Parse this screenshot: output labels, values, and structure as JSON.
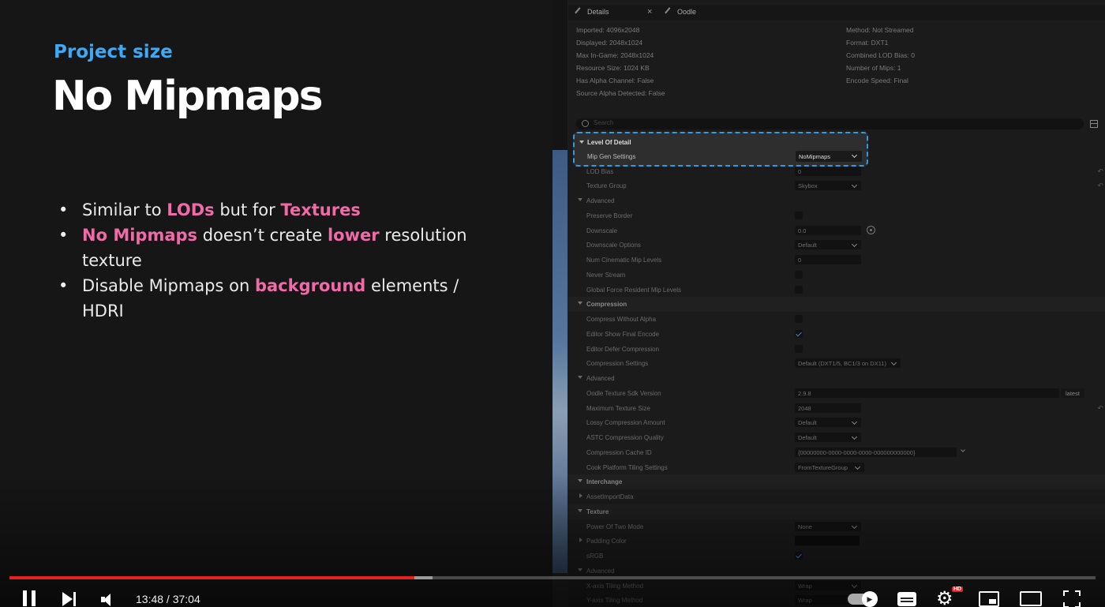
{
  "slide": {
    "subtitle": "Project size",
    "title": "No Mipmaps",
    "bullets": [
      {
        "parts": [
          [
            "Similar to ",
            false
          ],
          [
            "LODs",
            true
          ],
          [
            " but for ",
            false
          ],
          [
            "Textures",
            true
          ]
        ]
      },
      {
        "parts": [
          [
            "No Mipmaps",
            true
          ],
          [
            " doesn’t create ",
            false
          ],
          [
            "lower",
            true
          ],
          [
            " resolution texture",
            false
          ]
        ]
      },
      {
        "parts": [
          [
            "Disable Mipmaps on ",
            false
          ],
          [
            "background",
            true
          ],
          [
            " elements / HDRI",
            false
          ]
        ]
      }
    ],
    "highlight_color": "#f06aa8",
    "subtitle_color": "#3fa9f5"
  },
  "editor": {
    "tabs": {
      "details": "Details",
      "oodle": "Oodle",
      "close_glyph": "×"
    },
    "info_left": [
      "Imported: 4096x2048",
      "Displayed: 2048x1024",
      "Max In-Game: 2048x1024",
      "Resource Size: 1024 KB",
      "Has Alpha Channel: False",
      "Source Alpha Detected: False"
    ],
    "info_right": [
      "Method: Not Streamed",
      "Format: DXT1",
      "Combined LOD Bias: 0",
      "Number of Mips: 1",
      "Encode Speed: Final"
    ],
    "search_placeholder": "Search",
    "lod": {
      "section": "Level Of Detail",
      "mip_label": "Mip Gen Settings",
      "mip_value": "NoMipmaps"
    },
    "rows": [
      {
        "kind": "prop",
        "label": "LOD Bias",
        "control": "text",
        "value": "0",
        "reset": true
      },
      {
        "kind": "prop",
        "label": "Texture Group",
        "control": "dropdown",
        "value": "Skybox",
        "reset": true
      },
      {
        "kind": "sub",
        "label": "Advanced"
      },
      {
        "kind": "prop",
        "label": "Preserve Border",
        "control": "check",
        "checked": false
      },
      {
        "kind": "prop",
        "label": "Downscale",
        "control": "text",
        "value": "0.0",
        "plus": true
      },
      {
        "kind": "prop",
        "label": "Downscale Options",
        "control": "dropdown",
        "value": "Default"
      },
      {
        "kind": "prop",
        "label": "Num Cinematic Mip Levels",
        "control": "text",
        "value": "0"
      },
      {
        "kind": "prop",
        "label": "Never Stream",
        "control": "check",
        "checked": false
      },
      {
        "kind": "prop",
        "label": "Global Force Resident Mip Levels",
        "control": "check",
        "checked": false
      },
      {
        "kind": "sec",
        "label": "Compression"
      },
      {
        "kind": "prop",
        "label": "Compress Without Alpha",
        "control": "check",
        "checked": false
      },
      {
        "kind": "prop",
        "label": "Editor Show Final Encode",
        "control": "check",
        "checked": true
      },
      {
        "kind": "prop",
        "label": "Editor Defer Compression",
        "control": "check",
        "checked": false
      },
      {
        "kind": "prop",
        "label": "Compression Settings",
        "control": "dropdown-wide",
        "value": "Default (DXT1/5, BC1/3 on DX11)"
      },
      {
        "kind": "sub",
        "label": "Advanced"
      },
      {
        "kind": "prop",
        "label": "Oodle Texture Sdk Version",
        "control": "text-wide",
        "value": "2.9.8",
        "latest": "latest"
      },
      {
        "kind": "prop",
        "label": "Maximum Texture Size",
        "control": "text",
        "value": "2048",
        "reset": true
      },
      {
        "kind": "prop",
        "label": "Lossy Compression Amount",
        "control": "dropdown",
        "value": "Default"
      },
      {
        "kind": "prop",
        "label": "ASTC Compression Quality",
        "control": "dropdown",
        "value": "Default"
      },
      {
        "kind": "prop",
        "label": "Compression Cache ID",
        "control": "cache",
        "value": "{00000000-0000-0000-0000-000000000000}"
      },
      {
        "kind": "prop",
        "label": "Cook Platform Tiling Settings",
        "control": "dropdown",
        "value": "FromTextureGroup"
      },
      {
        "kind": "sec",
        "label": "Interchange"
      },
      {
        "kind": "coll",
        "label": "AssetImportData"
      },
      {
        "kind": "sec",
        "label": "Texture"
      },
      {
        "kind": "prop",
        "label": "Power Of Two Mode",
        "control": "dropdown",
        "value": "None"
      },
      {
        "kind": "coll",
        "label": "Padding Color",
        "control": "swatch"
      },
      {
        "kind": "prop",
        "label": "sRGB",
        "control": "check",
        "checked": true
      },
      {
        "kind": "sub",
        "label": "Advanced"
      },
      {
        "kind": "prop",
        "label": "X-axis Tiling Method",
        "control": "dropdown",
        "value": "Wrap"
      },
      {
        "kind": "prop",
        "label": "Y-axis Tiling Method",
        "control": "dropdown",
        "value": "Wrap"
      }
    ],
    "reset_glyph": "↶"
  },
  "player": {
    "time": "13:48 / 37:04",
    "played_fraction": 0.3725,
    "buffered_fraction": 0.3895,
    "hd_badge": "HD",
    "settings_glyph": "⚙"
  }
}
